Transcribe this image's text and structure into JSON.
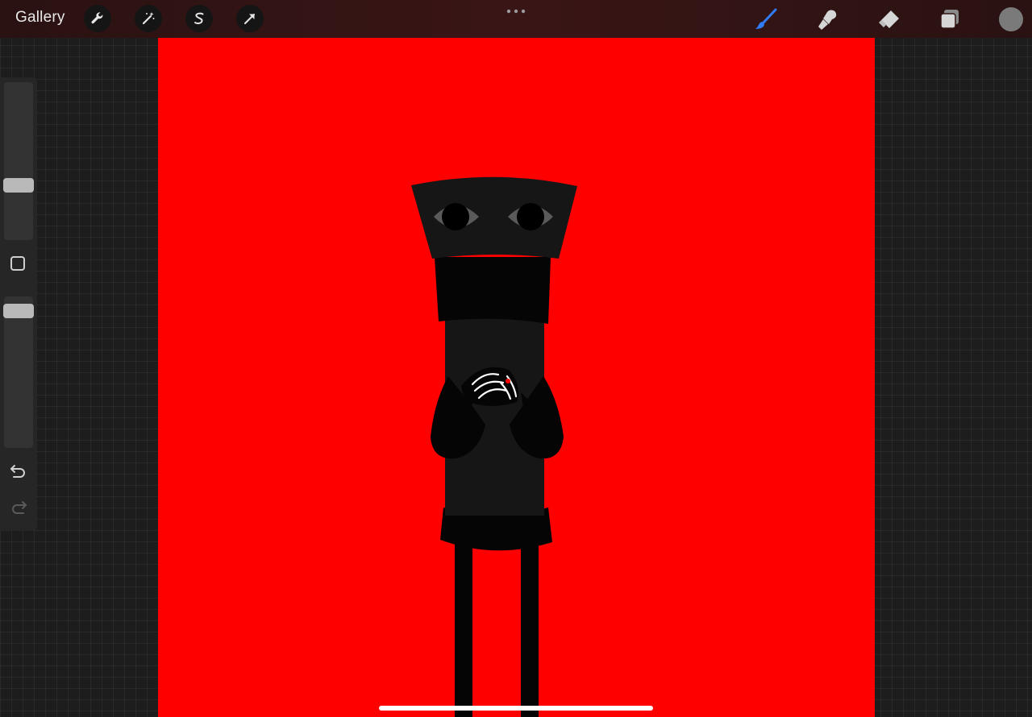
{
  "toolbar": {
    "gallery_label": "Gallery",
    "left_tools": [
      "wrench-icon",
      "magic-wand-icon",
      "selection-s-icon",
      "arrow-transform-icon"
    ],
    "right_tools": [
      "brush-icon",
      "smudge-icon",
      "eraser-icon",
      "layers-icon"
    ],
    "active_tool": "brush-icon",
    "accent_color": "#2f7cf6",
    "current_color": "#7a7a7a"
  },
  "sidebar": {
    "brush_size_level": 0.33,
    "opacity_level": 0.05,
    "controls": [
      "modify-button",
      "undo-icon",
      "redo-icon"
    ],
    "redo_enabled": false
  },
  "canvas": {
    "background_color": "#ff0000",
    "figure_colors": {
      "body": "#161616",
      "shadow": "#050505",
      "eye_ring": "#5a5a5a",
      "hand_lines": "#ffffff",
      "accent_dot": "#ff0000"
    }
  }
}
